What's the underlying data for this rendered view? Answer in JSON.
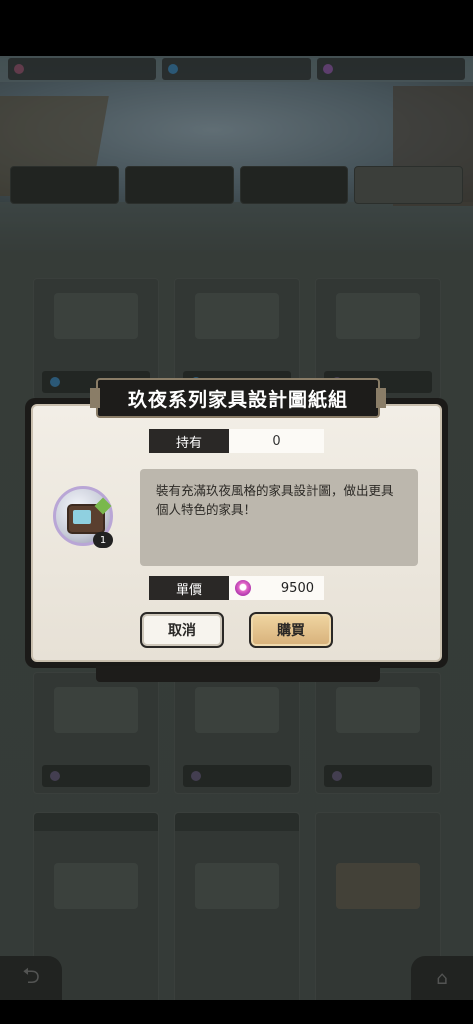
{
  "dialog": {
    "title": "玖夜系列家具設計圖紙組",
    "own_label": "持有",
    "own_value": "0",
    "description": "裝有充滿玖夜風格的家具設計圖，做出更具個人特色的家具！",
    "item_count": "1",
    "price_label": "單價",
    "price_value": "9500",
    "cancel_label": "取消",
    "buy_label": "購買"
  }
}
